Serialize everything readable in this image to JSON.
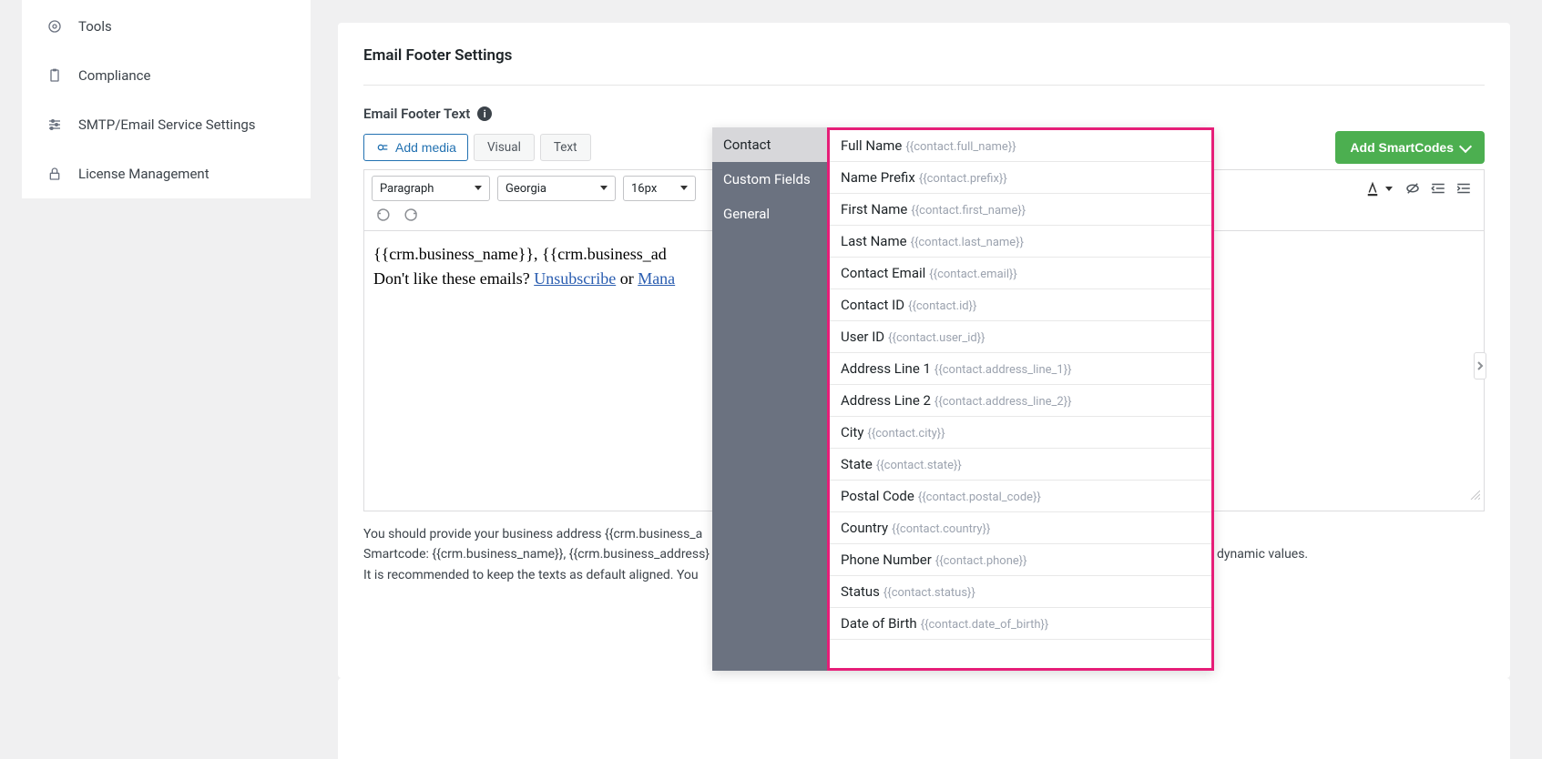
{
  "sidebar": {
    "items": [
      {
        "label": "Tools"
      },
      {
        "label": "Compliance"
      },
      {
        "label": "SMTP/Email Service Settings"
      },
      {
        "label": "License Management"
      }
    ]
  },
  "panel": {
    "title": "Email Footer Settings",
    "field_label": "Email Footer Text"
  },
  "editor_header": {
    "add_media": "Add media",
    "visual": "Visual",
    "text": "Text",
    "add_smartcodes": "Add SmartCodes"
  },
  "toolbar": {
    "format_select": "Paragraph",
    "font_select": "Georgia",
    "size_select": "16px"
  },
  "editor_content": {
    "line1_visible": "{{crm.business_name}}, {{crm.business_ad",
    "line2_prefix": "Don't like these emails? ",
    "unsubscribe": "Unsubscribe",
    "or": " or ",
    "manage_prefix": "Mana"
  },
  "hints": {
    "line1": "You should provide your business address {{crm.business_a",
    "line2_pre": "Smartcode: {{crm.business_name}}, {{crm.business_address}",
    "line2_post": " dynamic values.",
    "line3": "It is recommended to keep the texts as default aligned. You"
  },
  "dropdown": {
    "categories": [
      {
        "label": "Contact"
      },
      {
        "label": "Custom Fields"
      },
      {
        "label": "General"
      }
    ],
    "items": [
      {
        "label": "Full Name",
        "code": "{{contact.full_name}}"
      },
      {
        "label": "Name Prefix",
        "code": "{{contact.prefix}}"
      },
      {
        "label": "First Name",
        "code": "{{contact.first_name}}"
      },
      {
        "label": "Last Name",
        "code": "{{contact.last_name}}"
      },
      {
        "label": "Contact Email",
        "code": "{{contact.email}}"
      },
      {
        "label": "Contact ID",
        "code": "{{contact.id}}"
      },
      {
        "label": "User ID",
        "code": "{{contact.user_id}}"
      },
      {
        "label": "Address Line 1",
        "code": "{{contact.address_line_1}}"
      },
      {
        "label": "Address Line 2",
        "code": "{{contact.address_line_2}}"
      },
      {
        "label": "City",
        "code": "{{contact.city}}"
      },
      {
        "label": "State",
        "code": "{{contact.state}}"
      },
      {
        "label": "Postal Code",
        "code": "{{contact.postal_code}}"
      },
      {
        "label": "Country",
        "code": "{{contact.country}}"
      },
      {
        "label": "Phone Number",
        "code": "{{contact.phone}}"
      },
      {
        "label": "Status",
        "code": "{{contact.status}}"
      },
      {
        "label": "Date of Birth",
        "code": "{{contact.date_of_birth}}"
      }
    ]
  }
}
